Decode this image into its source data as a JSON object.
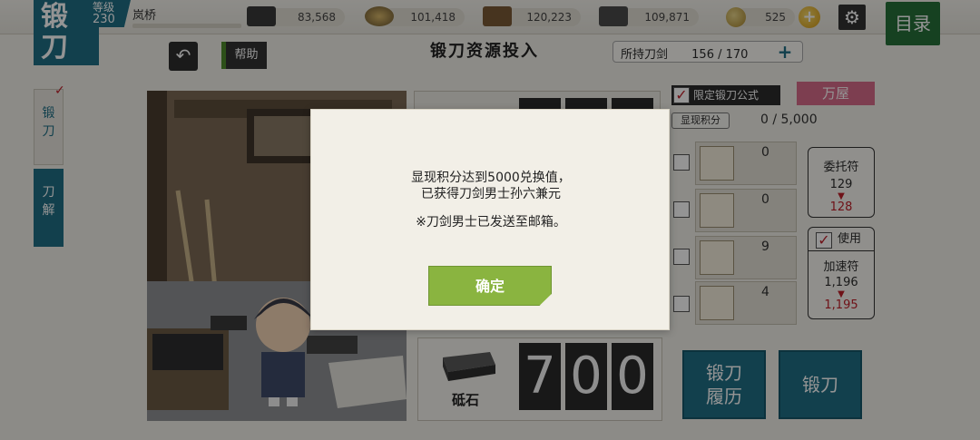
{
  "header": {
    "logo_text": "锻刀",
    "level_label": "等级",
    "level_value": "230",
    "player_name": "岚桥",
    "resources": [
      {
        "name": "charcoal",
        "icon": "charcoal-icon",
        "value": "83,568"
      },
      {
        "name": "tamahagane",
        "icon": "steel-icon",
        "value": "101,418"
      },
      {
        "name": "cooling-material",
        "icon": "cooling-icon",
        "value": "120,223"
      },
      {
        "name": "whetstone",
        "icon": "whetstone-icon",
        "value": "109,871"
      }
    ],
    "koban": "525",
    "menu_label": "目录"
  },
  "subheader": {
    "help_label": "帮助",
    "title": "锻刀资源投入",
    "owned_label": "所持刀剑",
    "owned_value": "156 / 170"
  },
  "side_tabs": {
    "forge": "锻\n刀",
    "dismantle": "刀\n解"
  },
  "panel": {
    "whetstone_label": "砥石",
    "digits": [
      "7",
      "0",
      "0"
    ],
    "limited_label": "限定锻刀公式",
    "shop_label": "万屋",
    "points_label": "显现积分",
    "points_value": "0 / 5,000",
    "items": [
      {
        "count": "0",
        "thumb": "item-a"
      },
      {
        "count": "0",
        "thumb": "item-b"
      },
      {
        "count": "9",
        "thumb": "item-c"
      },
      {
        "count": "4",
        "thumb": "item-d"
      }
    ],
    "request": {
      "label": "委托符",
      "value": "129",
      "after": "128"
    },
    "accel": {
      "use_label": "使用",
      "label": "加速符",
      "value": "1,196",
      "after": "1,195"
    },
    "history_label_1": "锻刀",
    "history_label_2": "履历",
    "forge_label": "锻刀"
  },
  "modal": {
    "line1": "显现积分达到5000兑换值，",
    "line2": "已获得刀剑男士孙六兼元",
    "line3": "※刀剑男士已发送至邮箱。",
    "confirm_label": "确定"
  },
  "colors": {
    "accent": "#1f6f86",
    "confirm": "#8ab440",
    "menu": "#26703a",
    "shop": "#d86b8a",
    "red": "#c0202a"
  }
}
